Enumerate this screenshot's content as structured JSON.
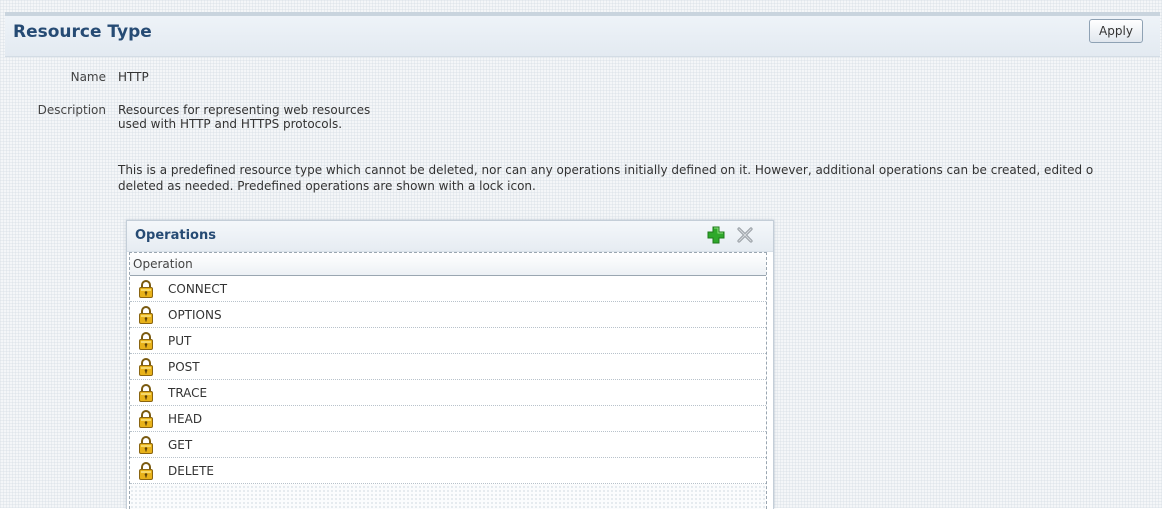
{
  "header": {
    "title": "Resource Type",
    "apply_label": "Apply"
  },
  "fields": {
    "name_label": "Name",
    "name_value": "HTTP",
    "description_label": "Description",
    "description_lines": [
      "Resources for representing web resources",
      "used with HTTP and HTTPS protocols."
    ]
  },
  "info_lines": [
    "This is a predefined resource type which cannot be deleted, nor can any operations initially defined on it. However, additional operations can be created, edited o",
    "deleted as needed. Predefined operations are shown with a lock icon."
  ],
  "operations": {
    "title": "Operations",
    "add_icon": "plus-icon",
    "delete_icon": "x-icon",
    "column_header": "Operation",
    "rows": [
      {
        "label": "CONNECT",
        "icon": "lock-icon"
      },
      {
        "label": "OPTIONS",
        "icon": "lock-icon"
      },
      {
        "label": "PUT",
        "icon": "lock-icon"
      },
      {
        "label": "POST",
        "icon": "lock-icon"
      },
      {
        "label": "TRACE",
        "icon": "lock-icon"
      },
      {
        "label": "HEAD",
        "icon": "lock-icon"
      },
      {
        "label": "GET",
        "icon": "lock-icon"
      },
      {
        "label": "DELETE",
        "icon": "lock-icon"
      }
    ]
  },
  "colors": {
    "title": "#264b74",
    "add_icon": "#2fa82b",
    "lock_body": "#e8b21a"
  }
}
